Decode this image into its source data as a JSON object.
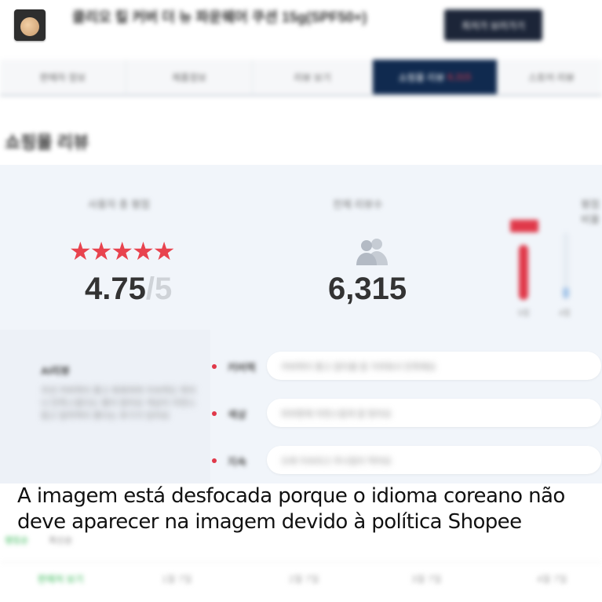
{
  "product": {
    "title": "클리오 킬 커버 더 뉴 파운웨어 쿠션 15g(SPF50+)",
    "buy_label": "최저가 보러가기"
  },
  "tabs": [
    {
      "label": "판매자 정보"
    },
    {
      "label": "제품정보"
    },
    {
      "label": "리뷰 보기"
    },
    {
      "label": "쇼핑몰 리뷰",
      "badge": "6,315"
    },
    {
      "label": "스토어 리뷰"
    }
  ],
  "review_section": {
    "title": "쇼핑몰 리뷰",
    "rating_label": "사용자 총 평점",
    "rating_value": "4.75",
    "rating_max": "/5",
    "stars": "★★★★★",
    "count_label": "전체 리뷰수",
    "count_value": "6,315",
    "dist_label": "평점비율",
    "dist_labels": [
      "5점",
      "4점"
    ],
    "distribution": [
      0.93,
      0.05
    ]
  },
  "summary": {
    "heading": "AI리뷰",
    "text": "쿠션 커버력이 좋고 촉촉하며 지속력도 뛰어나 만족스럽다는 평이 많아요 색상이 자연스럽고 밀착력이 좋다는 후기가 있어요",
    "rows": [
      {
        "key": "커버력",
        "value": "커버력이 좋고 잡티를 잘 가려줘서 만족해요"
      },
      {
        "key": "색상",
        "value": "피부톤에 자연스럽게 잘 맞아요"
      },
      {
        "key": "지속",
        "value": "오래 지속되고 무너짐이 적어요"
      }
    ]
  },
  "caption": {
    "line1": "A imagem está desfocada porque o idioma coreano não",
    "line2": "deve aparecer na imagem devido à política Shopee"
  },
  "bottom": {
    "tab_active": "랭킹순",
    "tab_other": "최신순",
    "row": [
      "판매처 보기",
      "1월 7일",
      "2월 7일",
      "3월 7일",
      "4월 7일"
    ]
  },
  "colors": {
    "accent": "#e0394a",
    "nav_active": "#102a4f",
    "panel_bg": "#f1f5fa"
  }
}
